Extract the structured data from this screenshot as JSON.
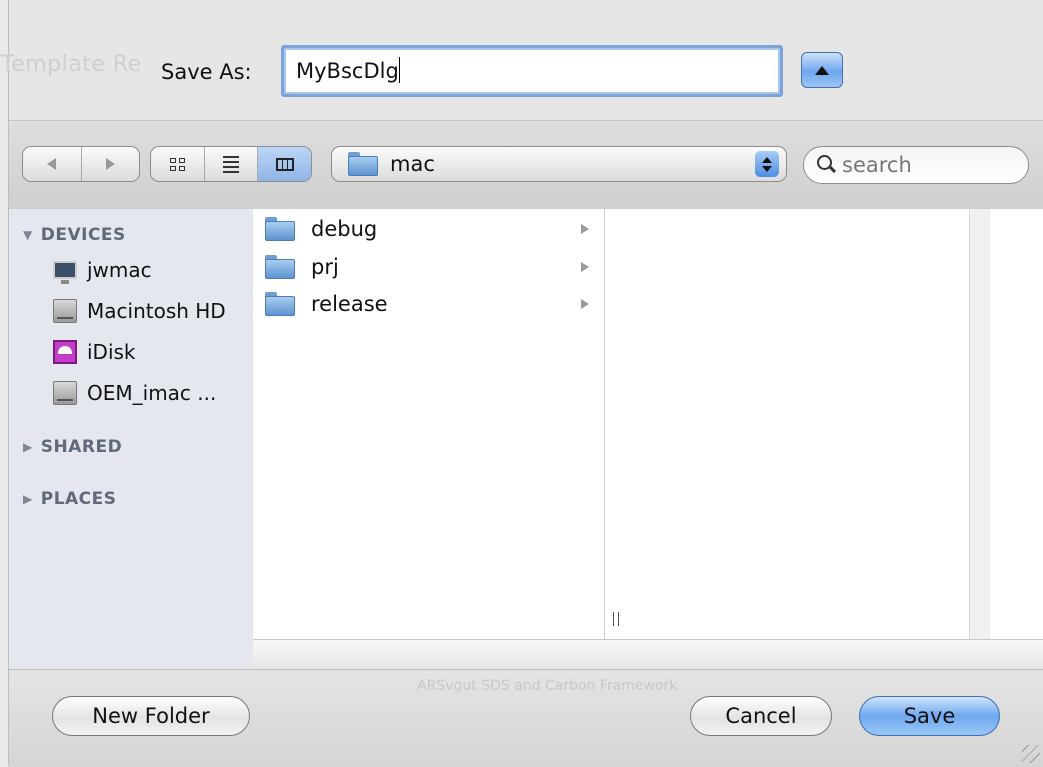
{
  "dialog": {
    "ghost_title": "Template Re",
    "save_as_label": "Save As:",
    "filename_value": "MyBscDlg",
    "ghost_status": "ARSvgut SDS and Carbon Framework"
  },
  "toolbar": {
    "location": "mac",
    "search_placeholder": "search"
  },
  "sidebar": {
    "devices_header": "DEVICES",
    "devices": [
      {
        "label": "jwmac",
        "icon": "computer-icon"
      },
      {
        "label": "Macintosh HD",
        "icon": "hard-drive-icon"
      },
      {
        "label": "iDisk",
        "icon": "idisk-icon"
      },
      {
        "label": "OEM_imac ...",
        "icon": "hard-drive-icon"
      }
    ],
    "shared_header": "SHARED",
    "places_header": "PLACES"
  },
  "browser": {
    "column1": [
      {
        "label": "debug"
      },
      {
        "label": "prj"
      },
      {
        "label": "release"
      }
    ]
  },
  "buttons": {
    "new_folder": "New Folder",
    "cancel": "Cancel",
    "save": "Save"
  },
  "colors": {
    "accent": "#6fa8ef",
    "sidebar_bg": "#e4e8ee"
  }
}
